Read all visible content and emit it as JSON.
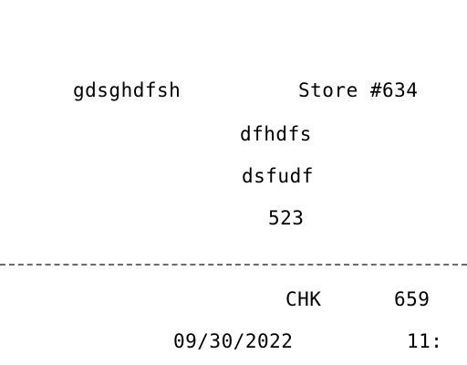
{
  "receipt": {
    "store_name": "gdsghdfsh",
    "store_label": "Store #634",
    "address_line_1": "dfhdfs",
    "address_line_2": "dsfudf",
    "address_line_3": "523",
    "check_label": "CHK",
    "check_number": "659",
    "date": "09/30/2022",
    "time": "11:"
  }
}
